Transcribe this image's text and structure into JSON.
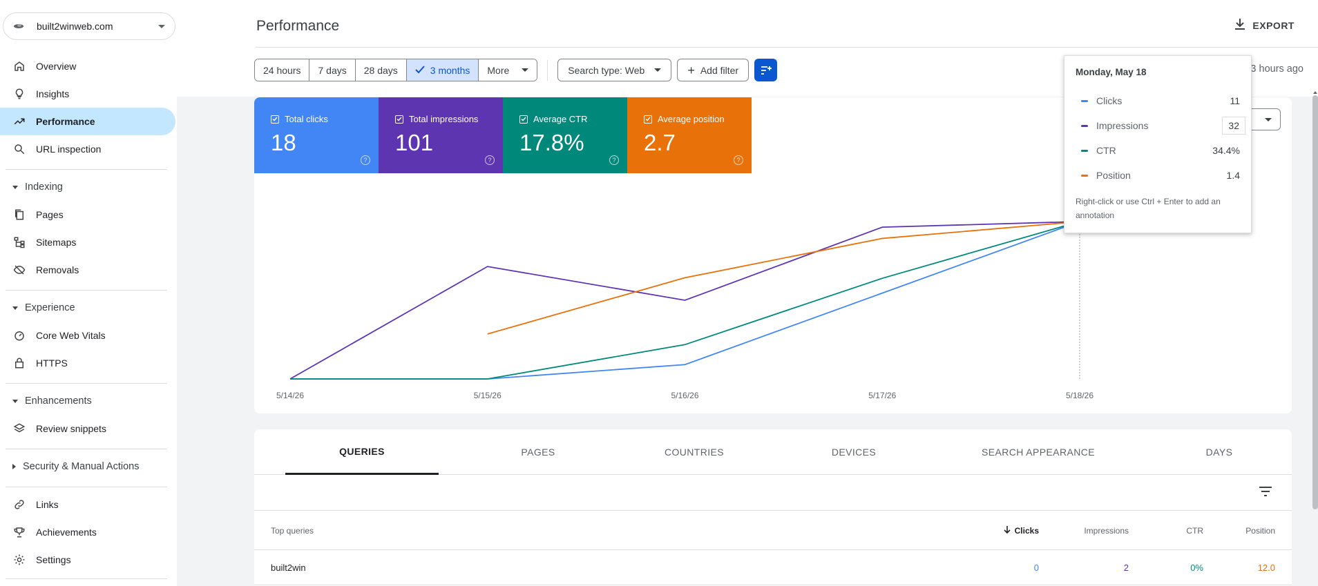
{
  "property": {
    "name": "built2winweb.com"
  },
  "sidebar": {
    "items": [
      {
        "label": "Overview",
        "icon": "home-icon"
      },
      {
        "label": "Insights",
        "icon": "lightbulb-icon"
      },
      {
        "label": "Performance",
        "icon": "trending-up-icon"
      },
      {
        "label": "URL inspection",
        "icon": "search-icon"
      }
    ],
    "indexing": {
      "title": "Indexing",
      "items": [
        {
          "label": "Pages",
          "icon": "pages-icon"
        },
        {
          "label": "Sitemaps",
          "icon": "sitemap-icon"
        },
        {
          "label": "Removals",
          "icon": "eye-off-icon"
        }
      ]
    },
    "experience": {
      "title": "Experience",
      "items": [
        {
          "label": "Core Web Vitals",
          "icon": "gauge-icon"
        },
        {
          "label": "HTTPS",
          "icon": "lock-icon"
        }
      ]
    },
    "enhancements": {
      "title": "Enhancements",
      "items": [
        {
          "label": "Review snippets",
          "icon": "layers-icon"
        }
      ]
    },
    "security": {
      "title": "Security & Manual Actions"
    },
    "bottom": [
      {
        "label": "Links",
        "icon": "link-icon"
      },
      {
        "label": "Achievements",
        "icon": "trophy-icon"
      },
      {
        "label": "Settings",
        "icon": "gear-icon"
      }
    ]
  },
  "header": {
    "title": "Performance",
    "export": "EXPORT"
  },
  "filters": {
    "ranges": [
      "24 hours",
      "7 days",
      "28 days",
      "3 months",
      "More"
    ],
    "search_type": "Search type: Web",
    "add_filter": "Add filter",
    "last_updated": "Last updated: 3 hours ago"
  },
  "metrics": [
    {
      "label": "Total clicks",
      "value": "18",
      "color": "#4285f4"
    },
    {
      "label": "Total impressions",
      "value": "101",
      "color": "#5e35b1"
    },
    {
      "label": "Average CTR",
      "value": "17.8%",
      "color": "#00897b"
    },
    {
      "label": "Average position",
      "value": "2.7",
      "color": "#e8710a"
    }
  ],
  "chart_data": {
    "type": "line",
    "x": [
      "5/14/26",
      "5/15/26",
      "5/16/26",
      "5/17/26",
      "5/18/26"
    ],
    "series": [
      {
        "name": "Clicks",
        "color": "#4285f4",
        "values": [
          0,
          0,
          1,
          6,
          11
        ]
      },
      {
        "name": "Impressions",
        "color": "#5e35b1",
        "values": [
          0,
          20,
          14,
          27,
          28
        ]
      },
      {
        "name": "CTR",
        "color": "#00897b",
        "values": [
          0,
          0,
          7.5,
          22,
          34.4
        ]
      },
      {
        "name": "Position",
        "color": "#e8710a",
        "values": [
          null,
          4,
          9,
          12.5,
          14
        ]
      }
    ],
    "grid": false,
    "legend": "none"
  },
  "tooltip": {
    "date": "Monday, May 18",
    "rows": [
      {
        "name": "Clicks",
        "value": "11",
        "color": "#4285f4"
      },
      {
        "name": "Impressions",
        "value": "32",
        "color": "#5e35b1"
      },
      {
        "name": "CTR",
        "value": "34.4%",
        "color": "#00897b"
      },
      {
        "name": "Position",
        "value": "1.4",
        "color": "#e8710a"
      }
    ],
    "note": "Right-click or use Ctrl + Enter to add an annotation"
  },
  "tabs": [
    "QUERIES",
    "PAGES",
    "COUNTRIES",
    "DEVICES",
    "SEARCH APPEARANCE",
    "DAYS"
  ],
  "table": {
    "columns": [
      "Top queries",
      "Clicks",
      "Impressions",
      "CTR",
      "Position"
    ],
    "rows": [
      {
        "query": "built2win",
        "clicks": "0",
        "impressions": "2",
        "ctr": "0%",
        "position": "12.0"
      }
    ]
  }
}
